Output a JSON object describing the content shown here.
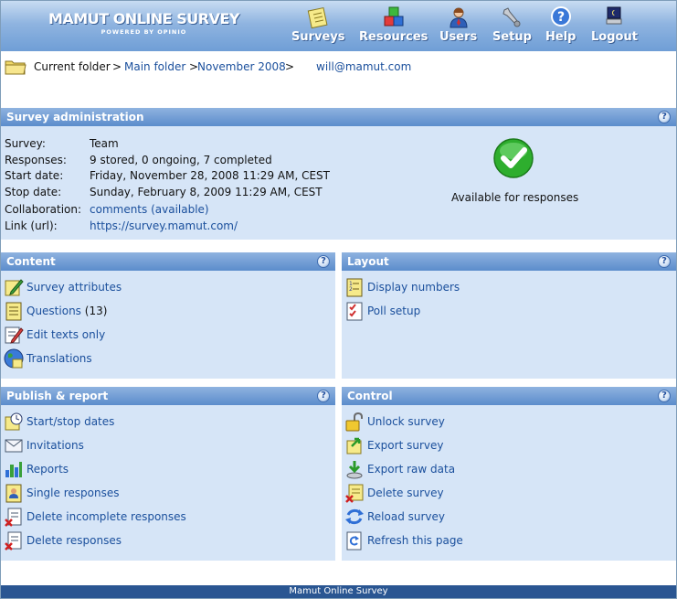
{
  "app": {
    "logo_main": "MAMUT ONLINE SURVEY",
    "logo_sub": "POWERED BY OPINIO"
  },
  "nav": {
    "surveys": "Surveys",
    "resources": "Resources",
    "users": "Users",
    "setup": "Setup",
    "help": "Help",
    "logout": "Logout"
  },
  "breadcrumb": {
    "prefix": "Current folder",
    "sep": ">",
    "main_folder": "Main folder",
    "sub_folder": "November 2008",
    "user": "will@mamut.com"
  },
  "admin": {
    "title": "Survey administration",
    "help": "?",
    "survey_label": "Survey:",
    "survey_value": "Team",
    "responses_label": "Responses:",
    "responses_value": "9 stored, 0 ongoing, 7 completed",
    "start_label": "Start date:",
    "start_value": "Friday, November 28, 2008 11:29 AM, CEST",
    "stop_label": "Stop date:",
    "stop_value": "Sunday, February 8, 2009 11:29 AM, CEST",
    "collab_label": "Collaboration:",
    "collab_value": "comments (available)",
    "link_label": "Link (url):",
    "link_value": "https://survey.mamut.com/",
    "status_text": "Available for responses"
  },
  "content": {
    "title": "Content",
    "help": "?",
    "survey_attributes": "Survey attributes",
    "questions": "Questions",
    "questions_count": "(13)",
    "edit_texts": "Edit texts only",
    "translations": "Translations"
  },
  "layout": {
    "title": "Layout",
    "help": "?",
    "display_numbers": "Display numbers",
    "poll_setup": "Poll setup"
  },
  "publish": {
    "title": "Publish & report",
    "help": "?",
    "start_stop": "Start/stop dates",
    "invitations": "Invitations",
    "reports": "Reports",
    "single_responses": "Single responses",
    "delete_incomplete": "Delete incomplete responses",
    "delete_responses": "Delete responses"
  },
  "control": {
    "title": "Control",
    "help": "?",
    "unlock": "Unlock survey",
    "export": "Export survey",
    "export_raw": "Export raw data",
    "delete_survey": "Delete survey",
    "reload": "Reload survey",
    "refresh": "Refresh this page"
  },
  "footer": {
    "text": "Mamut Online Survey"
  },
  "colors": {
    "header": "#6f9ed6",
    "panel_bg": "#d6e5f7",
    "panel_title": "#5b8ccc",
    "link": "#1a4f9c",
    "footer": "#2a5692",
    "status_ok": "#2eae2e"
  },
  "icons": {
    "surveys": "notepad-icon",
    "resources": "blocks-icon",
    "users": "user-icon",
    "setup": "wrench-icon",
    "help": "help-icon",
    "logout": "logout-icon",
    "status": "checkmark-icon"
  }
}
